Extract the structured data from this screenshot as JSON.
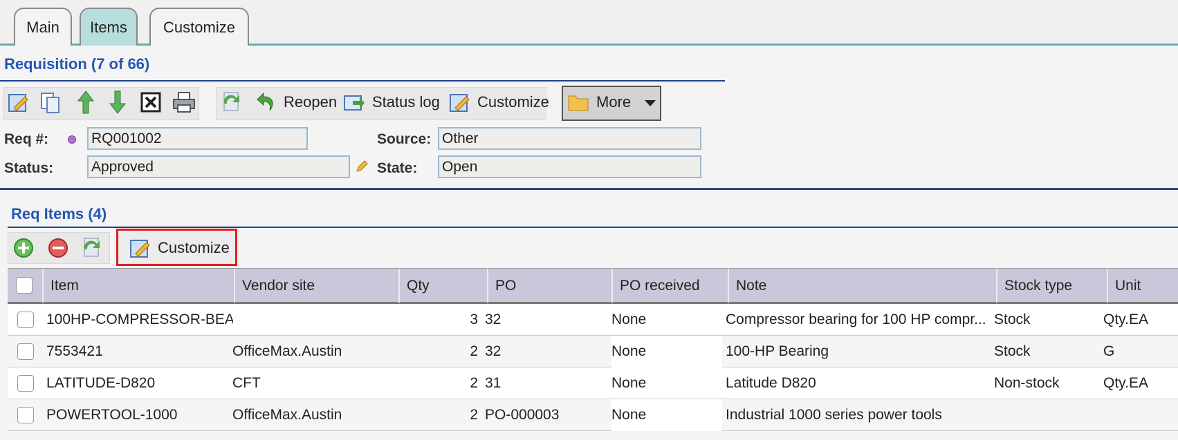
{
  "tabs": [
    {
      "label": "Main"
    },
    {
      "label": "Items"
    },
    {
      "label": "Customize"
    }
  ],
  "requisition": {
    "title": "Requisition (7 of 66)",
    "toolbar": {
      "reopen": "Reopen",
      "status_log": "Status log",
      "customize": "Customize",
      "more": "More"
    },
    "fields": {
      "req_label": "Req #:",
      "req_value": "RQ001002",
      "source_label": "Source:",
      "source_value": "Other",
      "status_label": "Status:",
      "status_value": "Approved",
      "state_label": "State:",
      "state_value": "Open"
    }
  },
  "req_items": {
    "title": "Req Items (4)",
    "toolbar": {
      "customize": "Customize"
    },
    "columns": [
      "Item",
      "Vendor site",
      "Qty",
      "PO",
      "PO received",
      "Note",
      "Stock type",
      "Unit"
    ],
    "rows": [
      {
        "item": "100HP-COMPRESSOR-BEA...",
        "vendor": "",
        "qty": "3",
        "po": "32",
        "po_received": "None",
        "note": "Compressor bearing for 100 HP compr...",
        "stock": "Stock",
        "unit": "Qty.EA"
      },
      {
        "item": "7553421",
        "vendor": "OfficeMax.Austin",
        "qty": "2",
        "po": "32",
        "po_received": "None",
        "note": "100-HP Bearing",
        "stock": "Stock",
        "unit": "G"
      },
      {
        "item": "LATITUDE-D820",
        "vendor": "CFT",
        "qty": "2",
        "po": "31",
        "po_received": "None",
        "note": "Latitude D820",
        "stock": "Non-stock",
        "unit": "Qty.EA"
      },
      {
        "item": "POWERTOOL-1000",
        "vendor": "OfficeMax.Austin",
        "qty": "2",
        "po": "PO-000003",
        "po_received": "None",
        "note": "Industrial 1000 series power tools",
        "stock": "",
        "unit": ""
      }
    ]
  },
  "colors": {
    "accent_blue": "#2657b4",
    "highlight_red": "#e01b24",
    "active_tab": "#b7dede"
  }
}
